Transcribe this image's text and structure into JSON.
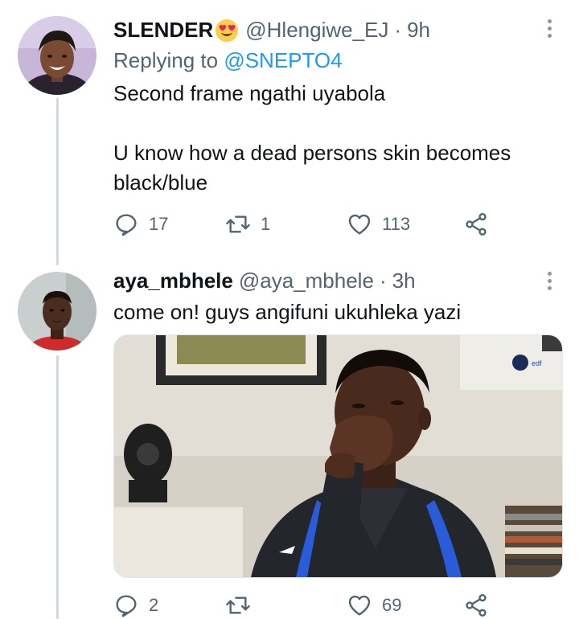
{
  "tweets": [
    {
      "name": "SLENDER",
      "emoji": "heart-eyes-emoji",
      "handle": "@Hlengiwe_EJ",
      "time": "9h",
      "replying_label": "Replying to",
      "replying_to": "@SNEPTO4",
      "text": "Second frame ngathi uyabola\n\nU know how a dead persons skin becomes black/blue",
      "replies": "17",
      "retweets": "1",
      "likes": "113"
    },
    {
      "name": "aya_mbhele",
      "handle": "@aya_mbhele",
      "time": "3h",
      "text": "come on! guys angifuni ukuhleka yazi",
      "replies": "2",
      "retweets": "",
      "likes": "69",
      "media": "photo of a laughing man in a dark tracksuit covering his mouth with his hand"
    }
  ],
  "separator": "·",
  "colors": {
    "text": "#0f1419",
    "secondary": "#536471",
    "link": "#1d9bf0",
    "thread_line": "#cfd9de"
  }
}
